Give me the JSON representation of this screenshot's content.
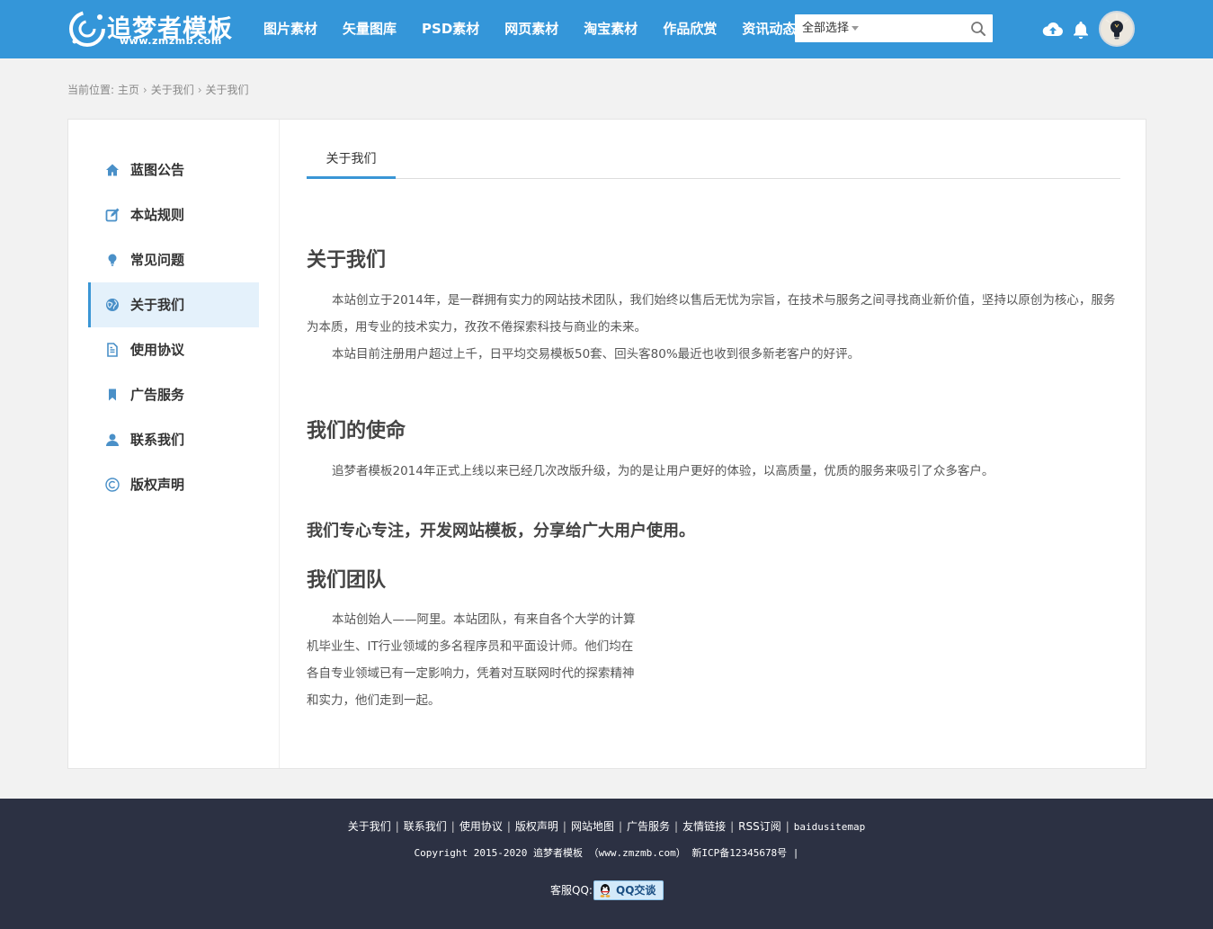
{
  "header": {
    "logo_title": "追梦者模板",
    "logo_sub": "www.zmzmb.com",
    "nav": [
      "图片素材",
      "矢量图库",
      "PSD素材",
      "网页素材",
      "淘宝素材",
      "作品欣赏",
      "资讯动态"
    ],
    "search": {
      "select_label": "全部选择",
      "placeholder": ""
    }
  },
  "breadcrumb": {
    "prefix": "当前位置:",
    "items": [
      "主页",
      "关于我们",
      "关于我们"
    ]
  },
  "sidebar": {
    "items": [
      {
        "label": "蓝图公告",
        "icon": "home-icon"
      },
      {
        "label": "本站规则",
        "icon": "edit-icon"
      },
      {
        "label": "常见问题",
        "icon": "lightbulb-icon"
      },
      {
        "label": "关于我们",
        "icon": "globe-icon",
        "active": true
      },
      {
        "label": "使用协议",
        "icon": "document-icon"
      },
      {
        "label": "广告服务",
        "icon": "bookmark-icon"
      },
      {
        "label": "联系我们",
        "icon": "user-icon"
      },
      {
        "label": "版权声明",
        "icon": "copyright-icon"
      }
    ]
  },
  "content": {
    "tab": "关于我们",
    "about_title": "关于我们",
    "about_p1": "本站创立于2014年，是一群拥有实力的网站技术团队，我们始终以售后无忧为宗旨，在技术与服务之间寻找商业新价值，坚持以原创为核心，服务为本质，用专业的技术实力，孜孜不倦探索科技与商业的未来。",
    "about_p2": "本站目前注册用户超过上千，日平均交易模板50套、回头客80%最近也收到很多新老客户的好评。",
    "mission_title": "我们的使命",
    "mission_p1": "追梦者模板2014年正式上线以来已经几次改版升级，为的是让用户更好的体验，以高质量，优质的服务来吸引了众多客户。",
    "focus_title": "我们专心专注，开发网站模板，分享给广大用户使用。",
    "team_title": "我们团队",
    "team_p1": "本站创始人——阿里。本站团队，有来自各个大学的计算机毕业生、IT行业领域的多名程序员和平面设计师。他们均在各自专业领域已有一定影响力，凭着对互联网时代的探索精神和实力，他们走到一起。"
  },
  "footer": {
    "links": [
      "关于我们",
      "联系我们",
      "使用协议",
      "版权声明",
      "网站地图",
      "广告服务",
      "友情链接",
      "RSS订阅",
      "baidusitemap"
    ],
    "copyright": "Copyright 2015-2020 追梦者模板 （www.zmzmb.com） 新ICP备12345678号 |",
    "qq_label": "客服QQ:",
    "qq_button": "QQ交谈"
  },
  "colors": {
    "brand": "#3496d9",
    "footer_bg": "#2c3143",
    "active_bg": "#e4f1fb",
    "accent": "#3a96d5",
    "icon": "#4a90c8"
  }
}
